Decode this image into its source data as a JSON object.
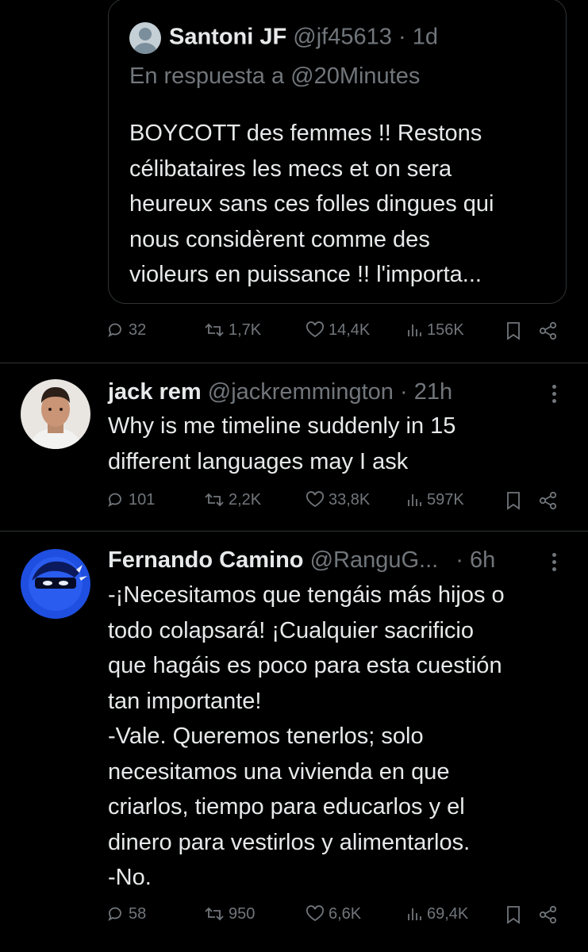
{
  "quoted": {
    "name": "Santoni JF",
    "handle": "@jf45613",
    "sep": "·",
    "time": "1d",
    "reply_to": "En respuesta a @20Minutes",
    "text": "BOYCOTT des femmes !! Restons\ncélibataires les mecs et on sera\nheureux sans ces folles dingues qui\nnous considèrent comme des\nvioleurs en puissance !! l'importa...",
    "stats": {
      "replies": "32",
      "retweets": "1,7K",
      "likes": "14,4K",
      "views": "156K"
    }
  },
  "tweets": [
    {
      "name": "jack rem",
      "handle": "@jackremmington",
      "sep": "·",
      "time": "21h",
      "text": "Why is me timeline suddenly in 15\ndifferent languages may I ask",
      "stats": {
        "replies": "101",
        "retweets": "2,2K",
        "likes": "33,8K",
        "views": "597K"
      }
    },
    {
      "name": "Fernando Camino",
      "handle": "@RanguG...",
      "sep": "·",
      "time": "6h",
      "text": "-¡Necesitamos que tengáis más hijos o\ntodo colapsará! ¡Cualquier sacrificio\nque hagáis es poco para esta cuestión\ntan importante!\n-Vale. Queremos tenerlos; solo\nnecesitamos una vivienda en que\ncriarlos, tiempo para educarlos y el\ndinero para vestirlos y alimentarlos.\n-No.",
      "stats": {
        "replies": "58",
        "retweets": "950",
        "likes": "6,6K",
        "views": "69,4K"
      }
    }
  ],
  "colors": {
    "background": "#000000",
    "text": "#e7e9ea",
    "muted": "#71767b",
    "divider": "#2f3336"
  },
  "icons": [
    "reply-icon",
    "retweet-icon",
    "like-icon",
    "views-icon",
    "bookmark-icon",
    "share-icon",
    "more-icon"
  ]
}
